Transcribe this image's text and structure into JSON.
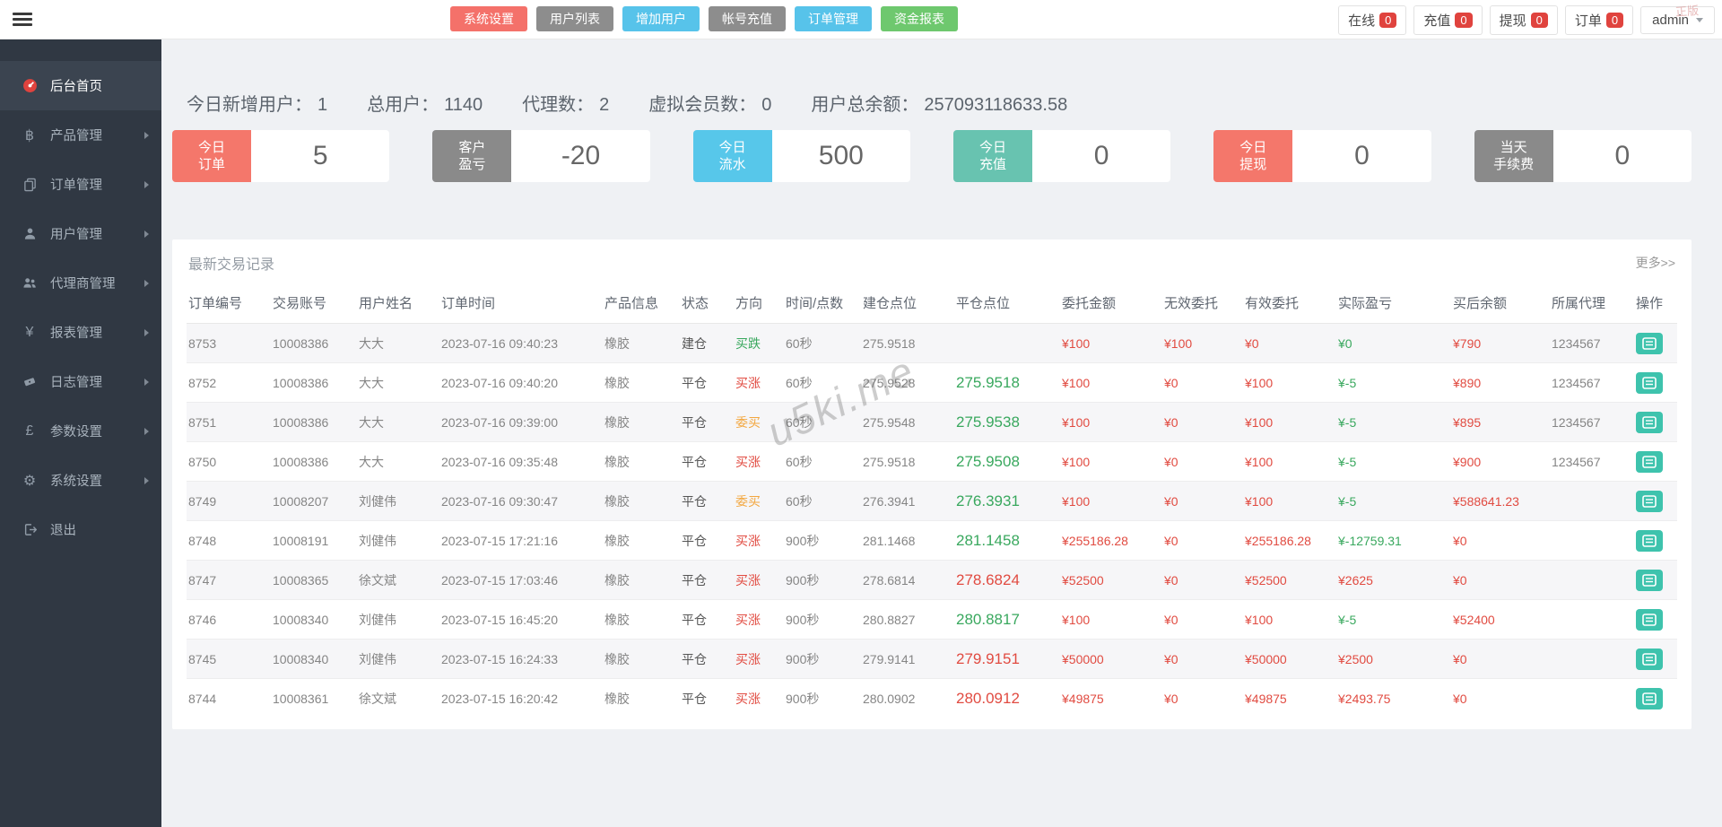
{
  "colors": {
    "accent_red": "#e14b41",
    "accent_green": "#39a85e",
    "accent_orange": "#f3a73f",
    "badge_red": "#e0433e",
    "action_teal": "#3ec3ad",
    "sidebar_bg": "#303843",
    "card_salmon": "#f4776b",
    "card_gray": "#8a8a8a",
    "card_blue": "#57c7ea",
    "card_teal": "#68c3b0"
  },
  "watermark": {
    "table": "u5ki.me",
    "corner": "正版"
  },
  "header": {
    "buttons": [
      {
        "label": "系统设置",
        "color": "#f4716a"
      },
      {
        "label": "用户列表",
        "color": "#8d8d8d"
      },
      {
        "label": "增加用户",
        "color": "#57c3ea"
      },
      {
        "label": "帐号充值",
        "color": "#8d8d8d"
      },
      {
        "label": "订单管理",
        "color": "#57c3ea"
      },
      {
        "label": "资金报表",
        "color": "#6ec86e"
      }
    ],
    "status_items": [
      {
        "label": "在线",
        "count": "0"
      },
      {
        "label": "充值",
        "count": "0"
      },
      {
        "label": "提现",
        "count": "0"
      },
      {
        "label": "订单",
        "count": "0"
      }
    ],
    "user": {
      "name": "admin"
    }
  },
  "sidebar": {
    "items": [
      {
        "label": "后台首页",
        "icon": "dashboard-icon",
        "active": true,
        "has_children": false
      },
      {
        "label": "产品管理",
        "icon": "bitcoin-icon",
        "active": false,
        "has_children": true
      },
      {
        "label": "订单管理",
        "icon": "copy-icon",
        "active": false,
        "has_children": true
      },
      {
        "label": "用户管理",
        "icon": "user-icon",
        "active": false,
        "has_children": true
      },
      {
        "label": "代理商管理",
        "icon": "users-icon",
        "active": false,
        "has_children": true
      },
      {
        "label": "报表管理",
        "icon": "yen-icon",
        "active": false,
        "has_children": true
      },
      {
        "label": "日志管理",
        "icon": "ticket-icon",
        "active": false,
        "has_children": true
      },
      {
        "label": "参数设置",
        "icon": "pound-icon",
        "active": false,
        "has_children": true
      },
      {
        "label": "系统设置",
        "icon": "gear-icon",
        "active": false,
        "has_children": true
      },
      {
        "label": "退出",
        "icon": "logout-icon",
        "active": false,
        "has_children": false
      }
    ]
  },
  "stats": [
    {
      "label": "今日新增用户：",
      "value": "1"
    },
    {
      "label": "总用户：",
      "value": "1140"
    },
    {
      "label": "代理数：",
      "value": "2"
    },
    {
      "label": "虚拟会员数：",
      "value": "0"
    },
    {
      "label": "用户总余额：",
      "value": "257093118633.58"
    }
  ],
  "cards": [
    {
      "label_lines": [
        "今日",
        "订单"
      ],
      "value": "5",
      "color": "#f4776b"
    },
    {
      "label_lines": [
        "客户",
        "盈亏"
      ],
      "value": "-20",
      "color": "#8a8a8a"
    },
    {
      "label_lines": [
        "今日",
        "流水"
      ],
      "value": "500",
      "color": "#57c7ea"
    },
    {
      "label_lines": [
        "今日",
        "充值"
      ],
      "value": "0",
      "color": "#68c3b0"
    },
    {
      "label_lines": [
        "今日",
        "提现"
      ],
      "value": "0",
      "color": "#f4776b"
    },
    {
      "label_lines": [
        "当天",
        "手续费"
      ],
      "value": "0",
      "color": "#8a8a8a"
    }
  ],
  "panel": {
    "title": "最新交易记录",
    "more": "更多>>",
    "columns": [
      "订单编号",
      "交易账号",
      "用户姓名",
      "订单时间",
      "产品信息",
      "状态",
      "方向",
      "时间/点数",
      "建仓点位",
      "平仓点位",
      "委托金额",
      "无效委托",
      "有效委托",
      "实际盈亏",
      "买后余额",
      "所属代理",
      "操作"
    ],
    "rows": [
      {
        "id": "8753",
        "account": "10008386",
        "name": "大大",
        "time": "2023-07-16 09:40:23",
        "product": "橡胶",
        "status": "建仓",
        "direction": {
          "text": "买跌",
          "color": "green"
        },
        "period": "60秒",
        "open": "275.9518",
        "close": {
          "text": "",
          "color": ""
        },
        "amount": "¥100",
        "invalid": "¥100",
        "valid": "¥0",
        "profit": {
          "text": "¥0",
          "color": "green"
        },
        "balance": "¥790",
        "agent": "1234567"
      },
      {
        "id": "8752",
        "account": "10008386",
        "name": "大大",
        "time": "2023-07-16 09:40:20",
        "product": "橡胶",
        "status": "平仓",
        "direction": {
          "text": "买涨",
          "color": "red"
        },
        "period": "60秒",
        "open": "275.9528",
        "close": {
          "text": "275.9518",
          "color": "green"
        },
        "amount": "¥100",
        "invalid": "¥0",
        "valid": "¥100",
        "profit": {
          "text": "¥-5",
          "color": "green"
        },
        "balance": "¥890",
        "agent": "1234567"
      },
      {
        "id": "8751",
        "account": "10008386",
        "name": "大大",
        "time": "2023-07-16 09:39:00",
        "product": "橡胶",
        "status": "平仓",
        "direction": {
          "text": "委买",
          "color": "orange"
        },
        "period": "60秒",
        "open": "275.9548",
        "close": {
          "text": "275.9538",
          "color": "green"
        },
        "amount": "¥100",
        "invalid": "¥0",
        "valid": "¥100",
        "profit": {
          "text": "¥-5",
          "color": "green"
        },
        "balance": "¥895",
        "agent": "1234567"
      },
      {
        "id": "8750",
        "account": "10008386",
        "name": "大大",
        "time": "2023-07-16 09:35:48",
        "product": "橡胶",
        "status": "平仓",
        "direction": {
          "text": "买涨",
          "color": "red"
        },
        "period": "60秒",
        "open": "275.9518",
        "close": {
          "text": "275.9508",
          "color": "green"
        },
        "amount": "¥100",
        "invalid": "¥0",
        "valid": "¥100",
        "profit": {
          "text": "¥-5",
          "color": "green"
        },
        "balance": "¥900",
        "agent": "1234567"
      },
      {
        "id": "8749",
        "account": "10008207",
        "name": "刘健伟",
        "time": "2023-07-16 09:30:47",
        "product": "橡胶",
        "status": "平仓",
        "direction": {
          "text": "委买",
          "color": "orange"
        },
        "period": "60秒",
        "open": "276.3941",
        "close": {
          "text": "276.3931",
          "color": "green"
        },
        "amount": "¥100",
        "invalid": "¥0",
        "valid": "¥100",
        "profit": {
          "text": "¥-5",
          "color": "green"
        },
        "balance": "¥588641.23",
        "agent": ""
      },
      {
        "id": "8748",
        "account": "10008191",
        "name": "刘健伟",
        "time": "2023-07-15 17:21:16",
        "product": "橡胶",
        "status": "平仓",
        "direction": {
          "text": "买涨",
          "color": "red"
        },
        "period": "900秒",
        "open": "281.1468",
        "close": {
          "text": "281.1458",
          "color": "green"
        },
        "amount": "¥255186.28",
        "invalid": "¥0",
        "valid": "¥255186.28",
        "profit": {
          "text": "¥-12759.31",
          "color": "green"
        },
        "balance": "¥0",
        "agent": ""
      },
      {
        "id": "8747",
        "account": "10008365",
        "name": "徐文斌",
        "time": "2023-07-15 17:03:46",
        "product": "橡胶",
        "status": "平仓",
        "direction": {
          "text": "买涨",
          "color": "red"
        },
        "period": "900秒",
        "open": "278.6814",
        "close": {
          "text": "278.6824",
          "color": "red"
        },
        "amount": "¥52500",
        "invalid": "¥0",
        "valid": "¥52500",
        "profit": {
          "text": "¥2625",
          "color": "red"
        },
        "balance": "¥0",
        "agent": ""
      },
      {
        "id": "8746",
        "account": "10008340",
        "name": "刘健伟",
        "time": "2023-07-15 16:45:20",
        "product": "橡胶",
        "status": "平仓",
        "direction": {
          "text": "买涨",
          "color": "red"
        },
        "period": "900秒",
        "open": "280.8827",
        "close": {
          "text": "280.8817",
          "color": "green"
        },
        "amount": "¥100",
        "invalid": "¥0",
        "valid": "¥100",
        "profit": {
          "text": "¥-5",
          "color": "green"
        },
        "balance": "¥52400",
        "agent": ""
      },
      {
        "id": "8745",
        "account": "10008340",
        "name": "刘健伟",
        "time": "2023-07-15 16:24:33",
        "product": "橡胶",
        "status": "平仓",
        "direction": {
          "text": "买涨",
          "color": "red"
        },
        "period": "900秒",
        "open": "279.9141",
        "close": {
          "text": "279.9151",
          "color": "red"
        },
        "amount": "¥50000",
        "invalid": "¥0",
        "valid": "¥50000",
        "profit": {
          "text": "¥2500",
          "color": "red"
        },
        "balance": "¥0",
        "agent": ""
      },
      {
        "id": "8744",
        "account": "10008361",
        "name": "徐文斌",
        "time": "2023-07-15 16:20:42",
        "product": "橡胶",
        "status": "平仓",
        "direction": {
          "text": "买涨",
          "color": "red"
        },
        "period": "900秒",
        "open": "280.0902",
        "close": {
          "text": "280.0912",
          "color": "red"
        },
        "amount": "¥49875",
        "invalid": "¥0",
        "valid": "¥49875",
        "profit": {
          "text": "¥2493.75",
          "color": "red"
        },
        "balance": "¥0",
        "agent": ""
      }
    ]
  }
}
